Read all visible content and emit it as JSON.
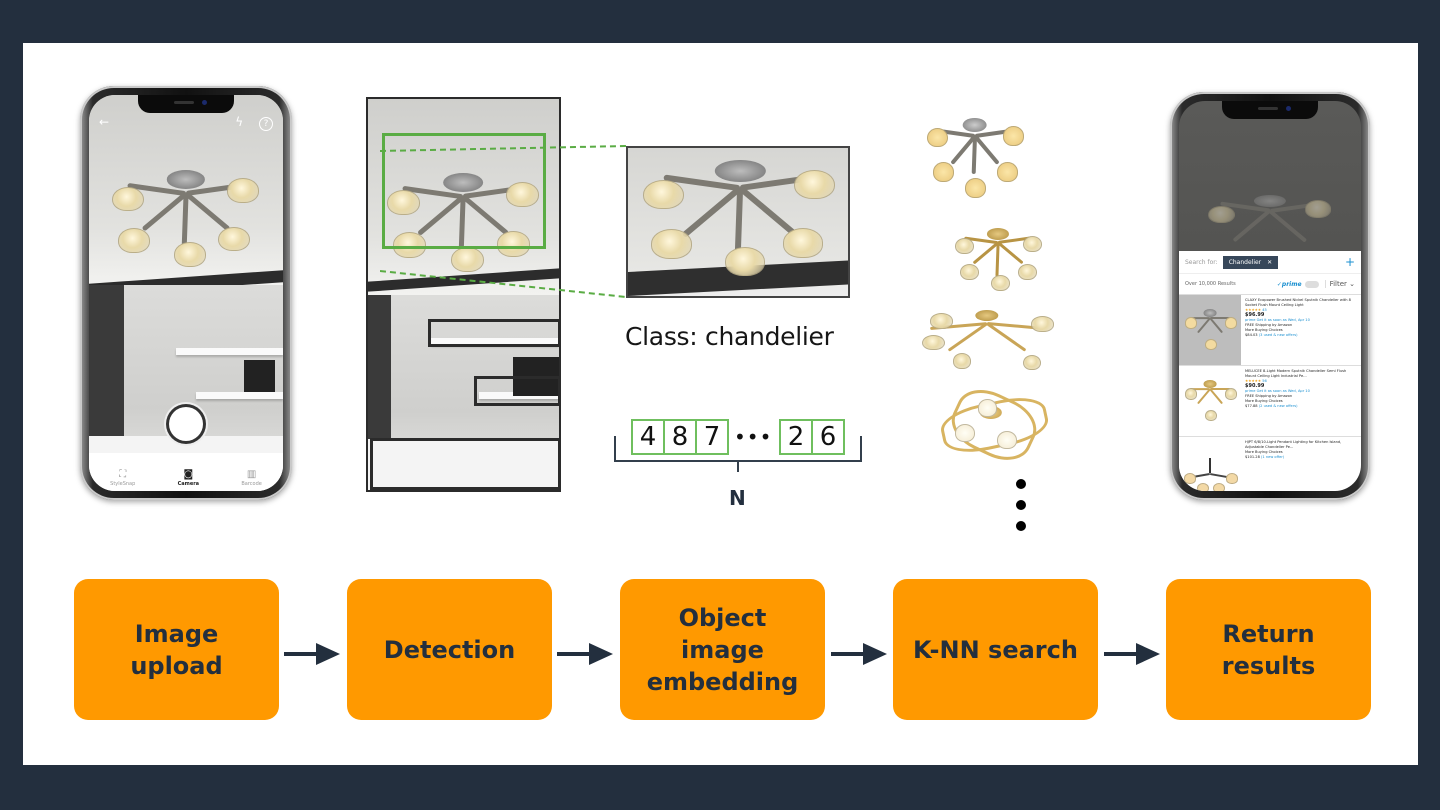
{
  "colors": {
    "background": "#232f3e",
    "panel": "#ffffff",
    "step_fill": "#ff9900",
    "step_text": "#232f3e",
    "detection_box": "#5aac44",
    "embedding_cell_border": "#6fbf5e"
  },
  "camera_phone": {
    "top_icons": [
      "back-arrow-icon",
      "flash-icon",
      "help-icon"
    ],
    "top_glyphs": {
      "back": "←",
      "flash": "ϟ",
      "help": "?"
    },
    "tabs": [
      {
        "label": "StyleSnap",
        "icon": "stylesnap-icon",
        "glyph": "⛶",
        "active": false
      },
      {
        "label": "Camera",
        "icon": "camera-icon",
        "glyph": "◙",
        "active": true
      },
      {
        "label": "Barcode",
        "icon": "barcode-icon",
        "glyph": "▥",
        "active": false
      }
    ]
  },
  "detection": {
    "detected_objects": 4,
    "highlighted_object": "chandelier"
  },
  "embedding": {
    "class_label": "Class: chandelier",
    "vector_head": [
      "4",
      "8",
      "7"
    ],
    "ellipsis": "•••",
    "vector_tail": [
      "2",
      "6"
    ],
    "dimension_label": "N"
  },
  "knn": {
    "candidates": 4,
    "more_indicator": "⋮"
  },
  "results_phone": {
    "search_for_label": "Search for:",
    "query_chip": "Chandelier",
    "chip_close": "✕",
    "add_icon": "+",
    "result_count": "Over 10,000 Results",
    "prime_label": "✓prime",
    "filter_label": "Filter ⌄",
    "results": [
      {
        "title": "CLAXY Ecopower Brushed Nickel Sputnik Chandelier with 8 Socket Flush Mount Ceiling Light",
        "stars": "★★★★★",
        "reviews": "45",
        "price": "$96.99",
        "shipping_note": "prime  Get it as soon as Wed, Apr 10",
        "free_shipping": "FREE Shipping by Amazon",
        "more_choices": "More Buying Choices",
        "alt_price": "$84.03",
        "offers": "(3 used & new offers)"
      },
      {
        "title": "MELUCEE 8-Light Modern Sputnik Chandelier Semi Flush Mount Ceiling Light Industrial Pe...",
        "stars": "★★★★★",
        "reviews": "56",
        "price": "$90.99",
        "shipping_note": "prime  Get it as soon as Wed, Apr 10",
        "free_shipping": "FREE Shipping by Amazon",
        "more_choices": "More Buying Choices",
        "alt_price": "$77.88",
        "offers": "(2 used & new offers)"
      },
      {
        "title": "HJPT 6/8/10-Light Pendant Lighting for Kitchen Island, Adjustable Chandelier Pe...",
        "more_choices": "More Buying Choices",
        "alt_price": "$101.28",
        "offers": "(1 new offer)"
      }
    ]
  },
  "pipeline": {
    "steps": [
      {
        "label": "Image\nupload"
      },
      {
        "label": "Detection"
      },
      {
        "label": "Object\nimage\nembedding"
      },
      {
        "label": "K-NN search"
      },
      {
        "label": "Return\nresults"
      }
    ],
    "arrow": "right-arrow-icon"
  }
}
